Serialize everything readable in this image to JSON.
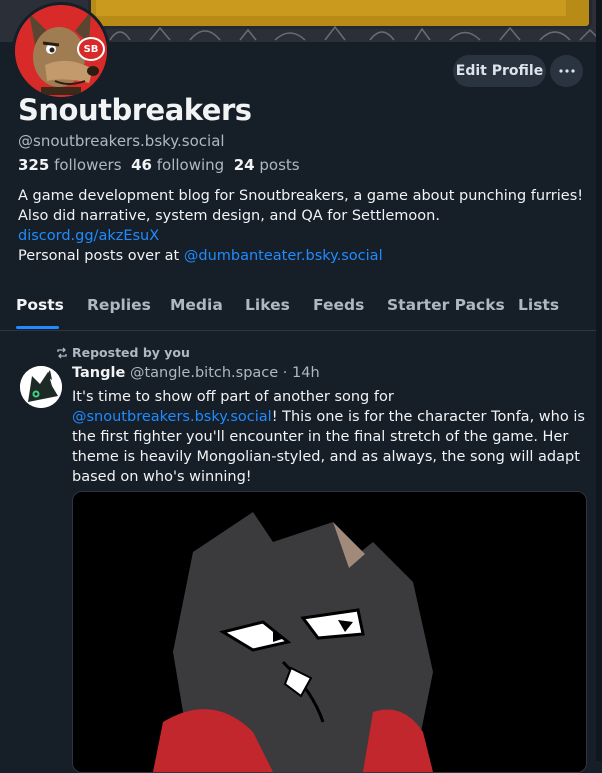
{
  "profile": {
    "display_name": "Snoutbreakers",
    "handle": "@snoutbreakers.bsky.social",
    "followers_count": "325",
    "followers_label": "followers",
    "following_count": "46",
    "following_label": "following",
    "posts_count": "24",
    "posts_label": "posts",
    "avatar_badge": "SB",
    "edit_button": "Edit Profile",
    "bio": {
      "line1": "A game development blog for Snoutbreakers, a game about punching furries!",
      "line2": "Also did narrative, system design, and QA for Settlemoon.",
      "link": "discord.gg/akzEsuX",
      "line4_prefix": "Personal posts over at ",
      "line4_mention": "@dumbanteater.bsky.social"
    }
  },
  "tabs": [
    {
      "label": "Posts",
      "active": true
    },
    {
      "label": "Replies",
      "active": false
    },
    {
      "label": "Media",
      "active": false
    },
    {
      "label": "Likes",
      "active": false
    },
    {
      "label": "Feeds",
      "active": false
    },
    {
      "label": "Starter Packs",
      "active": false
    },
    {
      "label": "Lists",
      "active": false
    }
  ],
  "post": {
    "repost_label": "Reposted by you",
    "author_name": "Tangle",
    "author_handle": "@tangle.bitch.space",
    "separator": " · ",
    "time": "14h",
    "text_line1": "It's time to show off part of another song for",
    "text_mention": "@snoutbreakers.bsky.social",
    "text_line2_rest": "! This one is for the character Tonfa, who is",
    "text_line3": "the first fighter you'll encounter in the final stretch of the game. Her",
    "text_line4": "theme is heavily Mongolian-styled, and as always, the song will adapt",
    "text_line5": "based on who's winning!"
  },
  "colors": {
    "background": "#161e27",
    "accent": "#208bfe",
    "muted_text": "#aeb8c3",
    "button_bg": "#2a3441"
  }
}
